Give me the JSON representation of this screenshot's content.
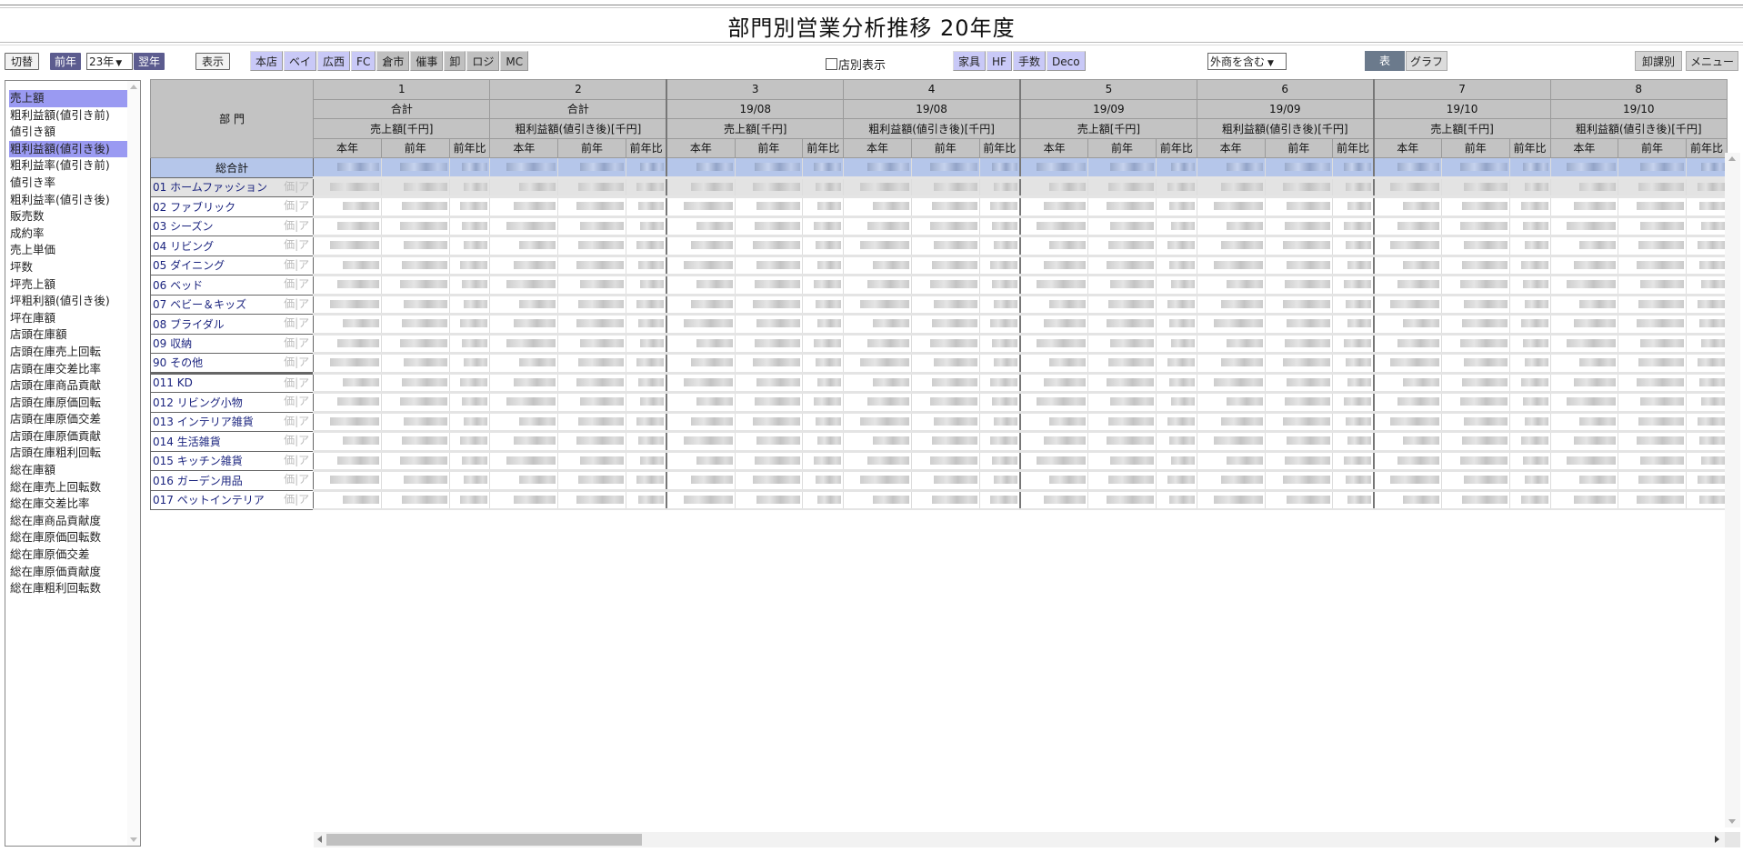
{
  "page": {
    "title": "部門別営業分析推移 20年度"
  },
  "toolbar": {
    "switch_label": "切替",
    "prev_year_label": "前年",
    "year_value": "23年",
    "next_year_label": "翌年",
    "display_label": "表示",
    "store_tabs": [
      {
        "label": "本店",
        "active": true
      },
      {
        "label": "ベイ",
        "active": true
      },
      {
        "label": "広西",
        "active": true
      },
      {
        "label": "FC",
        "active": true
      },
      {
        "label": "倉市",
        "active": false
      },
      {
        "label": "催事",
        "active": false
      },
      {
        "label": "卸",
        "active": false
      },
      {
        "label": "ロジ",
        "active": false
      },
      {
        "label": "MC",
        "active": false
      }
    ],
    "store_breakdown_label": "店別表示",
    "store_breakdown_checked": false,
    "category_tabs": [
      {
        "label": "家具",
        "active": true
      },
      {
        "label": "HF",
        "active": true
      },
      {
        "label": "手数",
        "active": true
      },
      {
        "label": "Deco",
        "active": true
      }
    ],
    "outside_sales_value": "外商を含む",
    "view_tabs": [
      {
        "label": "表",
        "active": true
      },
      {
        "label": "グラフ",
        "active": false
      }
    ],
    "wholesale_label": "卸課別",
    "menu_label": "メニュー"
  },
  "sidebar": {
    "items": [
      {
        "label": "売上額",
        "selected": true
      },
      {
        "label": "粗利益額(値引き前)",
        "selected": false
      },
      {
        "label": "値引き額",
        "selected": false
      },
      {
        "label": "粗利益額(値引き後)",
        "selected": true
      },
      {
        "label": "粗利益率(値引き前)",
        "selected": false
      },
      {
        "label": "値引き率",
        "selected": false
      },
      {
        "label": "粗利益率(値引き後)",
        "selected": false
      },
      {
        "label": "販売数",
        "selected": false
      },
      {
        "label": "成約率",
        "selected": false
      },
      {
        "label": "売上単価",
        "selected": false
      },
      {
        "label": "坪数",
        "selected": false
      },
      {
        "label": "坪売上額",
        "selected": false
      },
      {
        "label": "坪粗利額(値引き後)",
        "selected": false
      },
      {
        "label": "坪在庫額",
        "selected": false
      },
      {
        "label": "店頭在庫額",
        "selected": false
      },
      {
        "label": "店頭在庫売上回転",
        "selected": false
      },
      {
        "label": "店頭在庫交差比率",
        "selected": false
      },
      {
        "label": "店頭在庫商品貢献",
        "selected": false
      },
      {
        "label": "店頭在庫原価回転",
        "selected": false
      },
      {
        "label": "店頭在庫原価交差",
        "selected": false
      },
      {
        "label": "店頭在庫原価貢献",
        "selected": false
      },
      {
        "label": "店頭在庫粗利回転",
        "selected": false
      },
      {
        "label": "総在庫額",
        "selected": false
      },
      {
        "label": "総在庫売上回転数",
        "selected": false
      },
      {
        "label": "総在庫交差比率",
        "selected": false
      },
      {
        "label": "総在庫商品貢献度",
        "selected": false
      },
      {
        "label": "総在庫原価回転数",
        "selected": false
      },
      {
        "label": "総在庫原価交差",
        "selected": false
      },
      {
        "label": "総在庫原価貢献度",
        "selected": false
      },
      {
        "label": "総在庫粗利回転数",
        "selected": false
      }
    ]
  },
  "grid": {
    "dept_header": "部 門",
    "sub_headers": [
      "本年",
      "前年",
      "前年比"
    ],
    "column_groups": [
      {
        "index": "1",
        "period": "合計",
        "metric": "売上額[千円]"
      },
      {
        "index": "2",
        "period": "合計",
        "metric": "粗利益額(値引き後)[千円]"
      },
      {
        "index": "3",
        "period": "19/08",
        "metric": "売上額[千円]"
      },
      {
        "index": "4",
        "period": "19/08",
        "metric": "粗利益額(値引き後)[千円]"
      },
      {
        "index": "5",
        "period": "19/09",
        "metric": "売上額[千円]"
      },
      {
        "index": "6",
        "period": "19/09",
        "metric": "粗利益額(値引き後)[千円]"
      },
      {
        "index": "7",
        "period": "19/10",
        "metric": "売上額[千円]"
      },
      {
        "index": "8",
        "period": "19/10",
        "metric": "粗利益額(値引き後)[千円]"
      }
    ],
    "row_links": {
      "price": "価",
      "area": "ア"
    },
    "values_note": "numeric cell values are blurred/redacted in the screenshot",
    "rows": [
      {
        "name": "総合計",
        "type": "total"
      },
      {
        "name": "01 ホームファッション",
        "type": "dept",
        "highlight": true
      },
      {
        "name": "02 ファブリック",
        "type": "dept"
      },
      {
        "name": "03 シーズン",
        "type": "dept"
      },
      {
        "name": "04 リビング",
        "type": "dept"
      },
      {
        "name": "05 ダイニング",
        "type": "dept"
      },
      {
        "name": "06 ベッド",
        "type": "dept"
      },
      {
        "name": "07 ベビー＆キッズ",
        "type": "dept"
      },
      {
        "name": "08 ブライダル",
        "type": "dept"
      },
      {
        "name": "09 収納",
        "type": "dept"
      },
      {
        "name": "90 その他",
        "type": "dept"
      },
      {
        "name": "011 KD",
        "type": "sub",
        "separator": true
      },
      {
        "name": "012 リビング小物",
        "type": "sub"
      },
      {
        "name": "013 インテリア雑貨",
        "type": "sub"
      },
      {
        "name": "014 生活雑貨",
        "type": "sub"
      },
      {
        "name": "015 キッチン雑貨",
        "type": "sub"
      },
      {
        "name": "016 ガーデン用品",
        "type": "sub"
      },
      {
        "name": "017 ペットインテリア",
        "type": "sub"
      }
    ]
  },
  "colors": {
    "selected_item": "#9a9af2",
    "active_tab": "#c9c9f7",
    "inactive_tab": "#c0c0c0",
    "dark_button": "#5c5c8f",
    "total_row": "#b5c6ea",
    "header_bg": "#c3c3c3",
    "dept_text": "#1a237e"
  }
}
